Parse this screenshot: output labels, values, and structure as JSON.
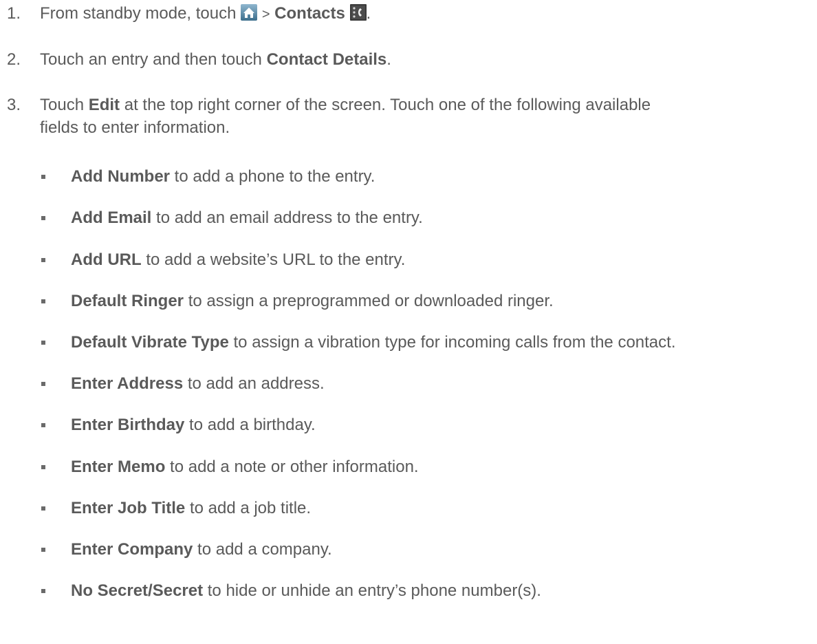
{
  "steps": [
    {
      "number": "1.",
      "prefix": "From standby mode, touch",
      "separator": ">",
      "bold": "Contacts",
      "suffix": ".",
      "icons": [
        "home-icon",
        "contacts-icon"
      ]
    },
    {
      "number": "2.",
      "prefix": "Touch an entry and then touch",
      "bold": "Contact Details",
      "suffix": "."
    },
    {
      "number": "3.",
      "prefix": "Touch",
      "bold": "Edit",
      "line1_rest": "at the top right corner of the screen. Touch one of the following available",
      "line2": "fields to enter information."
    }
  ],
  "fields": [
    {
      "bold": "Add Number",
      "desc": "to add a phone to the entry."
    },
    {
      "bold": "Add Email",
      "desc": "to add an email address to the entry."
    },
    {
      "bold": "Add URL",
      "desc": "to add a website’s URL to the entry."
    },
    {
      "bold": "Default Ringer",
      "desc": "to assign a preprogrammed or downloaded ringer."
    },
    {
      "bold": "Default Vibrate Type",
      "desc": "to assign a vibration type for incoming calls from the contact."
    },
    {
      "bold": "Enter Address",
      "desc": "to add an address."
    },
    {
      "bold": "Enter Birthday",
      "desc": "to add a birthday."
    },
    {
      "bold": "Enter Memo",
      "desc": "to add a note or other information."
    },
    {
      "bold": "Enter Job Title",
      "desc": "to add a job title."
    },
    {
      "bold": "Enter Company",
      "desc": "to add a company."
    },
    {
      "bold": "No Secret/Secret",
      "desc": "to hide or unhide an entry’s phone number(s)."
    }
  ],
  "colors": {
    "text": "#5a5a5a",
    "bullet": "#6a6a6a",
    "home_icon_bg": "#3d6e8c",
    "contacts_icon_bg": "#3a3a3a"
  }
}
